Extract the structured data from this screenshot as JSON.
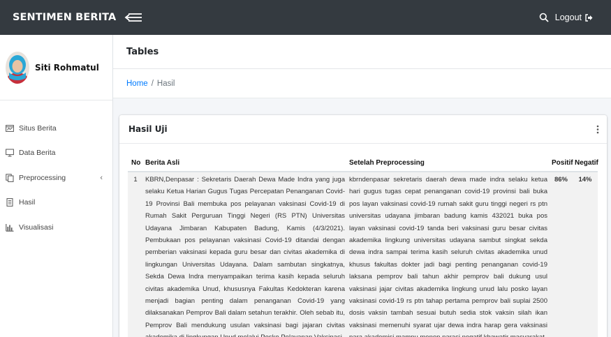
{
  "app": {
    "brand": "SENTIMEN BERITA",
    "logout_label": "Logout"
  },
  "user": {
    "name": "Siti Rohmatul"
  },
  "sidebar": {
    "items": [
      {
        "label": "Situs Berita",
        "icon": "globe-window-icon"
      },
      {
        "label": "Data Berita",
        "icon": "monitor-icon"
      },
      {
        "label": "Preprocessing",
        "icon": "copy-icon",
        "caret": "‹"
      },
      {
        "label": "Hasil",
        "icon": "document-icon"
      },
      {
        "label": "Visualisasi",
        "icon": "bar-chart-icon"
      }
    ]
  },
  "page": {
    "title": "Tables",
    "breadcrumb": {
      "home": "Home",
      "separator": "/",
      "current": "Hasil"
    }
  },
  "card": {
    "title": "Hasil Uji"
  },
  "table": {
    "headers": {
      "no": "No",
      "asli": "Berita Asli",
      "pre": "Setelah Preprocessing",
      "pos": "Positif",
      "neg": "Negatif"
    },
    "rows": [
      {
        "no": "1",
        "asli": "KBRN,Denpasar : Sekretaris Daerah Dewa Made Indra yang juga selaku Ketua Harian Gugus Tugas Percepatan Penanganan Covid-19 Provinsi Bali membuka pos pelayanan vaksinasi Covid-19 di Rumah Sakit Perguruan Tinggi Negeri (RS PTN) Universitas Udayana Jimbaran Kabupaten Badung, Kamis (4/3/2021). Pembukaan pos pelayanan vaksinasi Covid-19 ditandai dengan pemberian vaksinasi kepada guru besar dan civitas akademika di lingkungan Universitas Udayana. Dalam sambutan singkatnya, Sekda Dewa Indra menyampaikan terima kasih kepada seluruh civitas akademika Unud, khususnya Fakultas Kedokteran karena menjadi bagian penting dalam penanganan Covid-19 yang dilaksanakan Pemprov Bali dalam setahun terakhir. Oleh sebab itu, Pemprov Bali mendukung usulan vaksinasi bagi jajaran civitas akademika di lingkungan Unud melalui Posko Pelayanan Vaksinasi",
        "pre": "kbrndenpasar sekretaris daerah dewa made indra selaku ketua hari gugus tugas cepat penanganan covid-19 provinsi bali buka pos layan vaksinasi covid-19 rumah sakit guru tinggi negeri rs ptn universitas udayana jimbaran badung kamis 432021 buka pos layan vaksinasi covid-19 tanda beri vaksinasi guru besar civitas akademika lingkung universitas udayana sambut singkat sekda dewa indra sampai terima kasih seluruh civitas akademika unud khusus fakultas dokter jadi bagi penting penanganan covid-19 laksana pemprov bali tahun akhir pemprov bali dukung usul vaksinasi jajar civitas akademika lingkung unud lalu posko layan vaksinasi covid-19 rs ptn tahap pertama pemprov bali suplai 2500 dosis vaksin tambah sesuai butuh sedia stok vaksin silah ikan vaksinasi memenuhi syarat ujar dewa indra harap gera vaksinasi para akademisi mampu menep narasi negatif khawatir masyarakat",
        "pos": "86%",
        "neg": "14%"
      }
    ]
  },
  "colors": {
    "topbar": "#343a40",
    "link": "#007bff",
    "body_bg": "#f4f6f9"
  }
}
